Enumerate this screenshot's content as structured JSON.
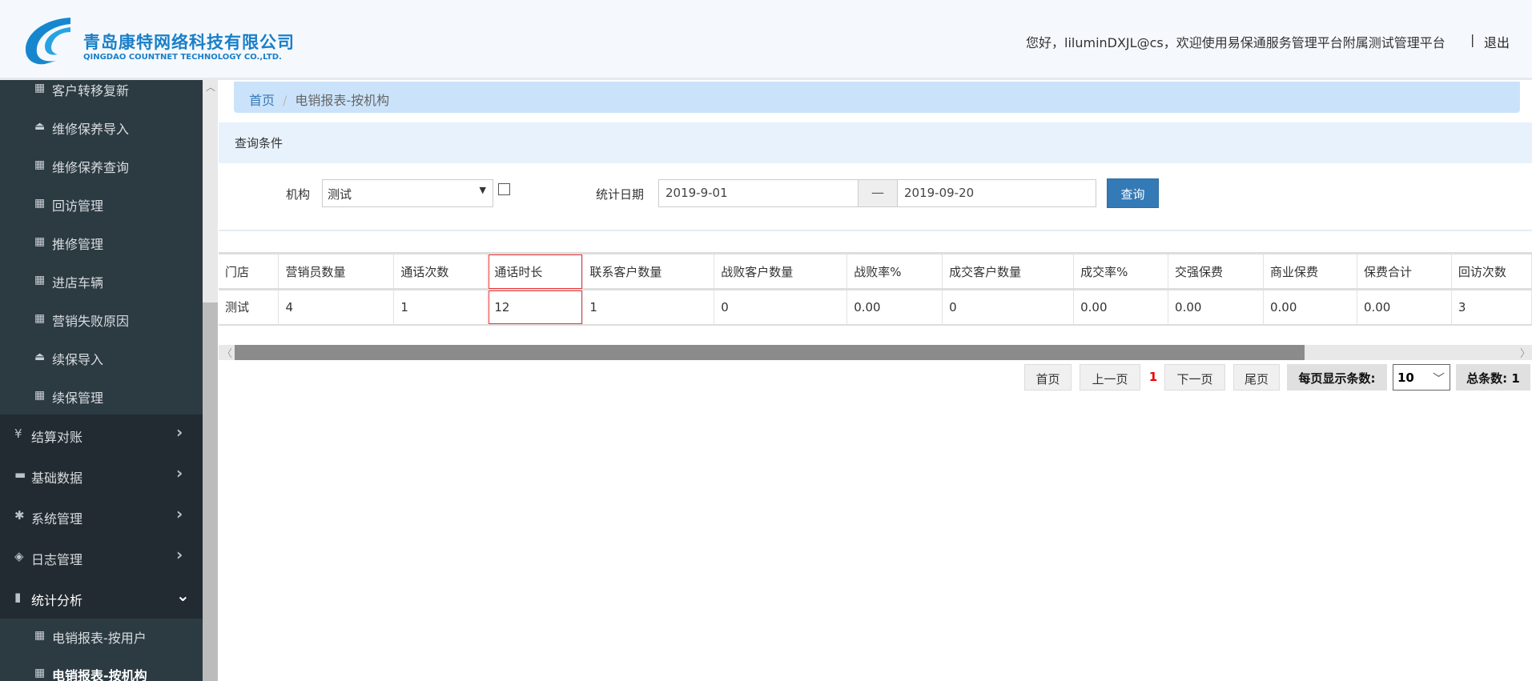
{
  "header": {
    "company_cn": "青岛康特网络科技有限公司",
    "company_en": "QINGDAO COUNTNET TECHNOLOGY CO.,LTD.",
    "welcome": "您好，liluminDXJL@cs，欢迎使用易保通服务管理平台附属测试管理平台",
    "separator": "|",
    "logout": "退出"
  },
  "sidebar": {
    "sub_items": [
      {
        "label": "客户转移复新",
        "icon": "grid-icon"
      },
      {
        "label": "维修保养导入",
        "icon": "import-icon"
      },
      {
        "label": "维修保养查询",
        "icon": "grid-icon"
      },
      {
        "label": "回访管理",
        "icon": "grid-icon"
      },
      {
        "label": "推修管理",
        "icon": "grid-icon"
      },
      {
        "label": "进店车辆",
        "icon": "grid-icon"
      },
      {
        "label": "营销失败原因",
        "icon": "grid-icon"
      },
      {
        "label": "续保导入",
        "icon": "import-icon"
      },
      {
        "label": "续保管理",
        "icon": "grid-icon"
      }
    ],
    "top_items": [
      {
        "label": "结算对账",
        "icon": "yen-icon"
      },
      {
        "label": "基础数据",
        "icon": "drive-icon"
      },
      {
        "label": "系统管理",
        "icon": "gear-icon"
      },
      {
        "label": "日志管理",
        "icon": "tags-icon"
      },
      {
        "label": "统计分析",
        "icon": "bar-chart-icon"
      }
    ],
    "stat_items": [
      {
        "label": "电销报表-按用户"
      },
      {
        "label": "电销报表-按机构",
        "active": true
      }
    ]
  },
  "breadcrumb": {
    "home": "首页",
    "sep": "/",
    "current": "电销报表-按机构"
  },
  "query": {
    "title": "查询条件",
    "org_label": "机构",
    "org_value": "测试",
    "date_label": "统计日期",
    "date_from": "2019-9-01",
    "date_sep": "—",
    "date_to": "2019-09-20",
    "search": "查询"
  },
  "table": {
    "headers": [
      "门店",
      "营销员数量",
      "通话次数",
      "通话时长",
      "联系客户数量",
      "战败客户数量",
      "战败率%",
      "成交客户数量",
      "成交率%",
      "交强保费",
      "商业保费",
      "保费合计",
      "回访次数"
    ],
    "rows": [
      [
        "测试",
        "4",
        "1",
        "12",
        "1",
        "0",
        "0.00",
        "0",
        "0.00",
        "0.00",
        "0.00",
        "0.00",
        "3"
      ]
    ]
  },
  "pagination": {
    "first": "首页",
    "prev": "上一页",
    "current": "1",
    "next": "下一页",
    "last": "尾页",
    "per_page_label": "每页显示条数:",
    "per_page": "10",
    "total": "总条数: 1"
  },
  "colors": {
    "accent": "#337ab7",
    "sidebar": "#2c3a42",
    "highlight": "#e33333"
  }
}
